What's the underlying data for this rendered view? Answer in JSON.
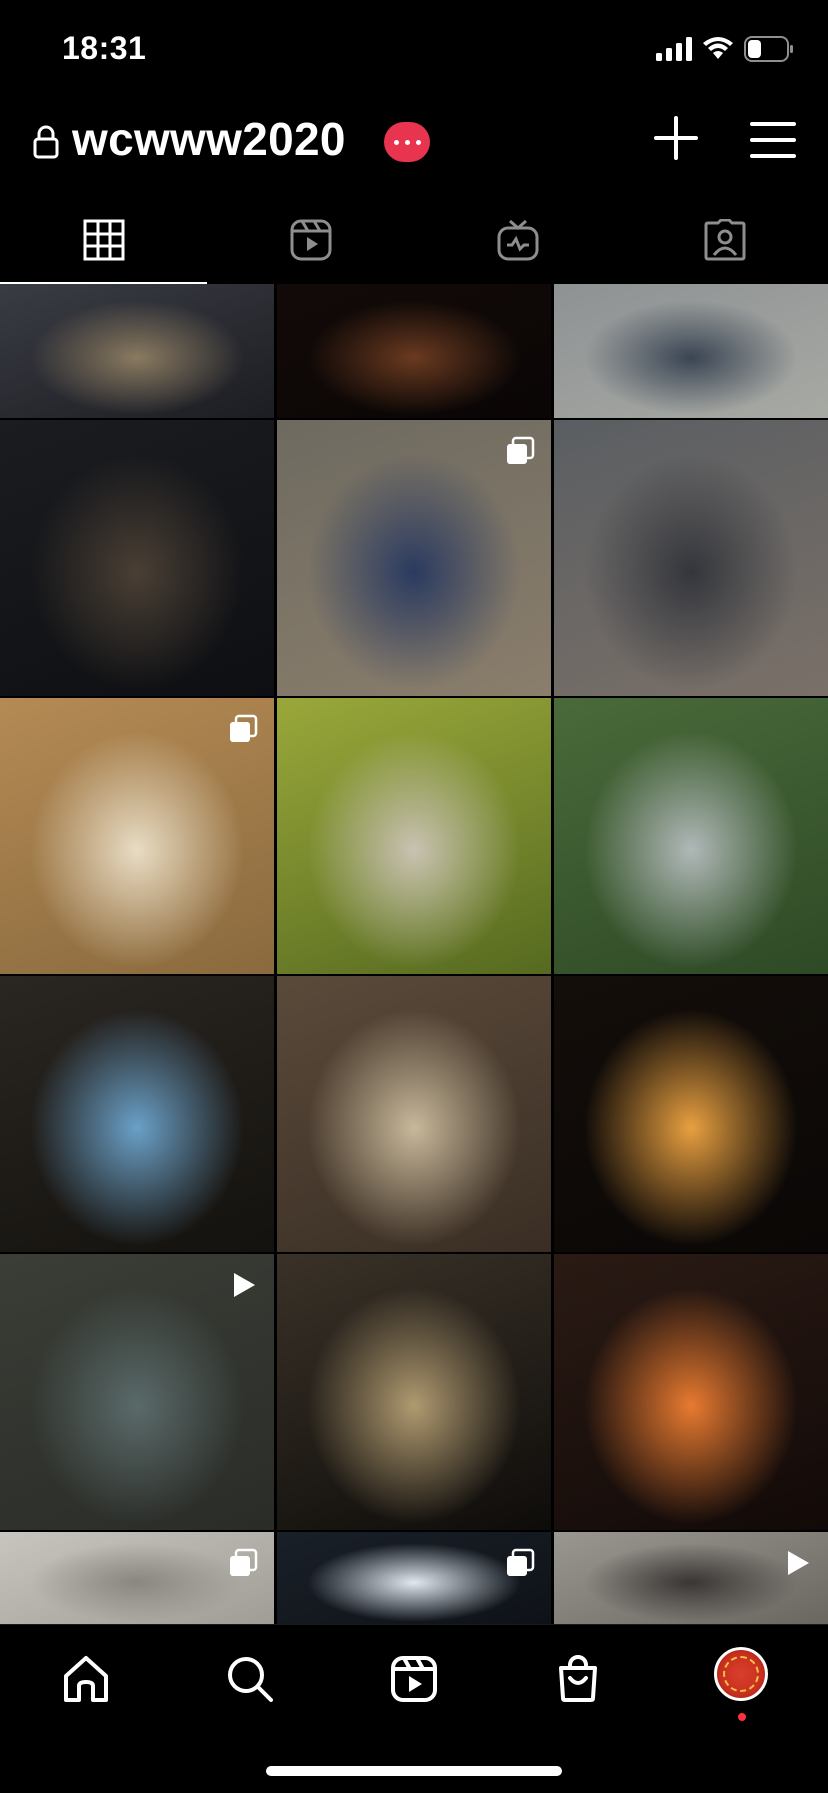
{
  "status_bar": {
    "time": "18:31"
  },
  "header": {
    "username": "wcwww2020"
  },
  "tabs": [
    {
      "name": "tab-posts-grid",
      "icon": "grid-icon",
      "active": true
    },
    {
      "name": "tab-reels",
      "icon": "reels-icon",
      "active": false
    },
    {
      "name": "tab-igtv",
      "icon": "igtv-icon",
      "active": false
    },
    {
      "name": "tab-tagged",
      "icon": "tagged-icon",
      "active": false
    }
  ],
  "posts": [
    {
      "name": "post-group-lantern-night",
      "badge": null,
      "colors": [
        "#3a3c44",
        "#8a7a60",
        "#1c1d22"
      ]
    },
    {
      "name": "post-campfire-dark",
      "badge": null,
      "colors": [
        "#120a08",
        "#6a3a20",
        "#0a0605"
      ]
    },
    {
      "name": "post-group-photo-bench",
      "badge": null,
      "colors": [
        "#8e9294",
        "#3a4554",
        "#a7a9a3"
      ]
    },
    {
      "name": "post-man-cooking-lantern",
      "badge": null,
      "colors": [
        "#1a1c20",
        "#4a3f34",
        "#0e0f12"
      ]
    },
    {
      "name": "post-group-dancing-outdoors",
      "badge": "multiple",
      "colors": [
        "#6e6a60",
        "#2a3a60",
        "#8a7e6c"
      ]
    },
    {
      "name": "post-group-selfie-village",
      "badge": null,
      "colors": [
        "#5a5e62",
        "#34363c",
        "#7a7068"
      ]
    },
    {
      "name": "post-ramen-bowl",
      "badge": "multiple",
      "colors": [
        "#b48a54",
        "#e8dcc4",
        "#8a6a3e"
      ]
    },
    {
      "name": "post-man-beanie-flower",
      "badge": null,
      "colors": [
        "#9aa83a",
        "#c9c2b2",
        "#566a20"
      ]
    },
    {
      "name": "post-man-climbing-tree",
      "badge": null,
      "colors": [
        "#4a6a3a",
        "#b0b8b8",
        "#2e4a26"
      ]
    },
    {
      "name": "post-temperature-screen",
      "badge": null,
      "colors": [
        "#2a2622",
        "#6aa0c8",
        "#14120e"
      ]
    },
    {
      "name": "post-group-meal-cabin",
      "badge": null,
      "colors": [
        "#5a4a3a",
        "#c8b89a",
        "#3a2e24"
      ]
    },
    {
      "name": "post-campfire-group",
      "badge": null,
      "colors": [
        "#140e0a",
        "#e8a040",
        "#0a0706"
      ]
    },
    {
      "name": "post-river-swimming",
      "badge": "video",
      "colors": [
        "#3a3e36",
        "#5a6a6a",
        "#2a2c28"
      ]
    },
    {
      "name": "post-tarp-camp-night",
      "badge": null,
      "colors": [
        "#3a3228",
        "#b09a70",
        "#0e0c0a"
      ]
    },
    {
      "name": "post-fire-pit-logs",
      "badge": null,
      "colors": [
        "#2a1a14",
        "#e87a30",
        "#120a08"
      ]
    },
    {
      "name": "post-blurry-person",
      "badge": "multiple",
      "colors": [
        "#c8c4be",
        "#8a8680",
        "#a09c96"
      ]
    },
    {
      "name": "post-ceiling-lights",
      "badge": "multiple",
      "colors": [
        "#1a2028",
        "#e0e8f0",
        "#0e1218"
      ]
    },
    {
      "name": "post-feet-walkway",
      "badge": "video",
      "colors": [
        "#9a9690",
        "#3a3634",
        "#6a6660"
      ]
    }
  ],
  "bottom_nav": [
    {
      "name": "nav-home",
      "icon": "home-icon"
    },
    {
      "name": "nav-search",
      "icon": "search-icon"
    },
    {
      "name": "nav-reels",
      "icon": "reels-icon"
    },
    {
      "name": "nav-shop",
      "icon": "shopping-bag-icon"
    },
    {
      "name": "nav-profile",
      "icon": "profile-avatar"
    }
  ]
}
